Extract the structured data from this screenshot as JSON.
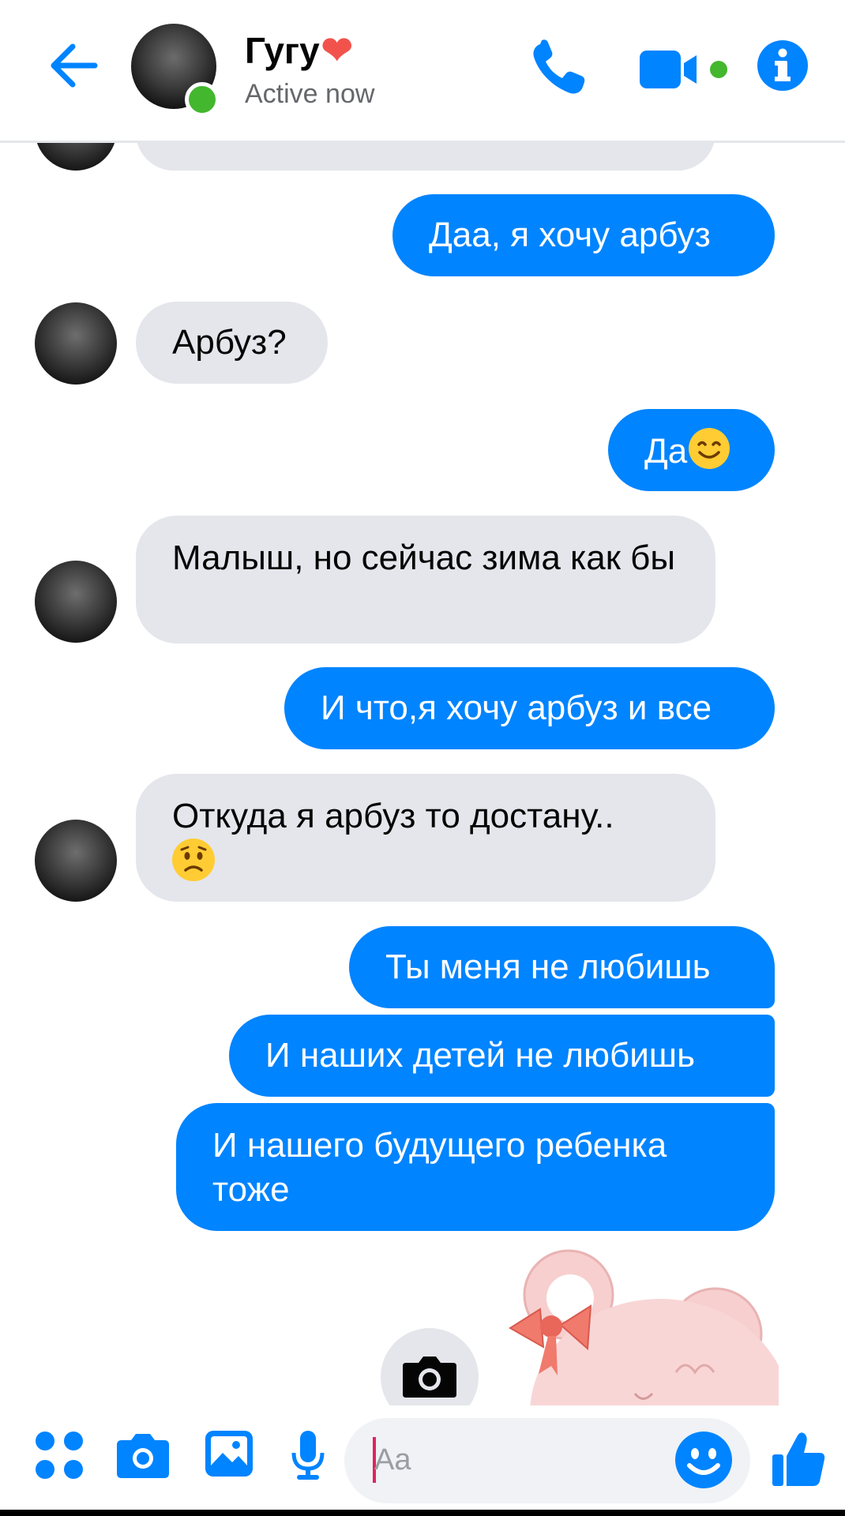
{
  "header": {
    "contact_name": "Гугу",
    "name_emoji": "❤",
    "status": "Active now"
  },
  "messages": [
    {
      "id": "m1",
      "side": "incoming",
      "text": "Даа, я хочу арбуз"
    },
    {
      "id": "m2",
      "side": "incoming",
      "text": "Арбуз?"
    },
    {
      "id": "m3",
      "side": "outgoing",
      "text": "Да"
    },
    {
      "id": "m4",
      "side": "incoming",
      "text": "Малыш, но сейчас зима как бы"
    },
    {
      "id": "m5",
      "side": "outgoing",
      "text": "И что,я хочу арбуз и все"
    },
    {
      "id": "m6",
      "side": "incoming",
      "text": "Откуда я арбуз то достану.."
    },
    {
      "id": "m7",
      "side": "outgoing",
      "text": "Ты меня не любишь"
    },
    {
      "id": "m8",
      "side": "outgoing",
      "text": "И наших детей не любишь"
    },
    {
      "id": "m9",
      "side": "outgoing",
      "text": "И нашего будущего ребенка тоже"
    }
  ],
  "composer": {
    "placeholder": "Aa"
  },
  "colors": {
    "accent": "#0084ff",
    "incoming_bubble": "#e4e6eb",
    "online": "#43b72e"
  },
  "icons": [
    "back-arrow-icon",
    "phone-icon",
    "video-icon",
    "info-icon",
    "apps-icon",
    "camera-icon",
    "gallery-icon",
    "mic-icon",
    "emoji-icon",
    "like-thumb-icon"
  ]
}
